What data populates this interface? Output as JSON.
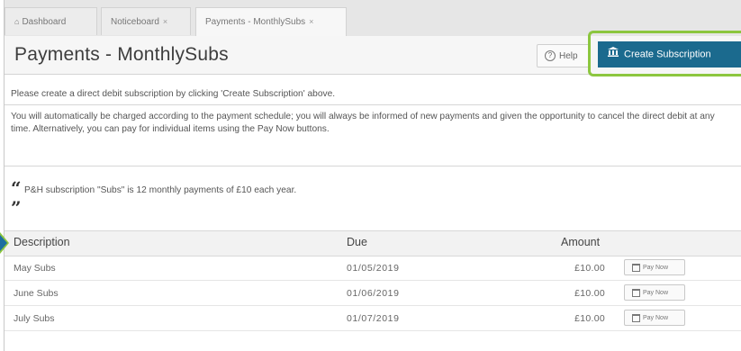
{
  "tabs": [
    {
      "label": "Dashboard",
      "active": false,
      "closable": false,
      "icon": "home-icon"
    },
    {
      "label": "Noticeboard",
      "active": false,
      "closable": true
    },
    {
      "label": "Payments - MonthlySubs",
      "active": true,
      "closable": true
    }
  ],
  "tab_close_glyph": "×",
  "header": {
    "title": "Payments - MonthlySubs",
    "help_label": "Help",
    "create_label": "Create Subscription",
    "accent_color": "#1b6a8e",
    "highlight_color": "#8cc63f"
  },
  "info": {
    "line1": "Please create a direct debit subscription by clicking 'Create Subscription' above.",
    "line2": "You will automatically be charged according to the payment schedule; you will always be informed of new payments and given the opportunity to cancel the direct debit at any time. Alternatively, you can pay for individual items using the Pay Now buttons."
  },
  "quote": {
    "text": "P&H subscription \"Subs\" is 12 monthly payments of £10 each year."
  },
  "table": {
    "headers": {
      "description": "Description",
      "due": "Due",
      "amount": "Amount"
    },
    "rows": [
      {
        "description": "May Subs",
        "due": "01/05/2019",
        "amount": "£10.00",
        "action": "Pay Now"
      },
      {
        "description": "June Subs",
        "due": "01/06/2019",
        "amount": "£10.00",
        "action": "Pay Now"
      },
      {
        "description": "July Subs",
        "due": "01/07/2019",
        "amount": "£10.00",
        "action": "Pay Now"
      }
    ]
  }
}
